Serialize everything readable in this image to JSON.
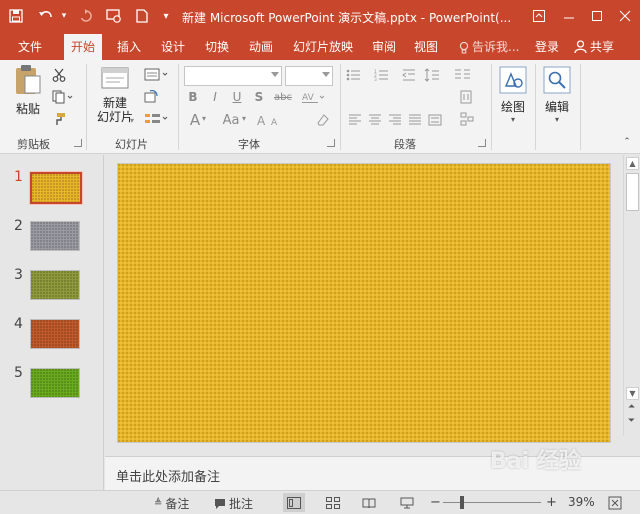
{
  "titlebar": {
    "title": "新建 Microsoft PowerPoint 演示文稿.pptx - PowerPoint(...",
    "quick_access": [
      "save-icon",
      "undo-icon",
      "redo-icon",
      "slideshow-icon",
      "new-doc-icon",
      "customize-icon"
    ]
  },
  "tabs": [
    "文件",
    "开始",
    "插入",
    "设计",
    "切换",
    "动画",
    "幻灯片放映",
    "审阅",
    "视图"
  ],
  "active_tab": "开始",
  "tell_me": "告诉我...",
  "login": "登录",
  "share": "共享",
  "ribbon": {
    "clipboard": {
      "paste": "粘贴",
      "label": "剪贴板"
    },
    "slides": {
      "new_slide_line1": "新建",
      "new_slide_line2": "幻灯片",
      "label": "幻灯片"
    },
    "font": {
      "label": "字体",
      "bold": "B",
      "italic": "I",
      "underline": "U",
      "shadow": "S",
      "strike": "abc",
      "font_color": "A",
      "change_case": "Aa"
    },
    "paragraph": {
      "label": "段落"
    },
    "drawing": {
      "label": "绘图"
    },
    "editing": {
      "label": "编辑"
    }
  },
  "thumbnails": [
    {
      "num": "1",
      "color": "#e8b628",
      "active": true
    },
    {
      "num": "2",
      "color": "#9a9aa2",
      "active": false
    },
    {
      "num": "3",
      "color": "#8f9a3a",
      "active": false
    },
    {
      "num": "4",
      "color": "#c05a2a",
      "active": false
    },
    {
      "num": "5",
      "color": "#6aaa1e",
      "active": false
    }
  ],
  "notes_placeholder": "单击此处添加备注",
  "status": {
    "notes": "备注",
    "comments": "批注",
    "zoom": "39%",
    "zoom_fraction": 0.39
  },
  "watermark": "Bai 经验",
  "colors": {
    "accent": "#c8462c",
    "slide_fill": "#e8b628"
  }
}
